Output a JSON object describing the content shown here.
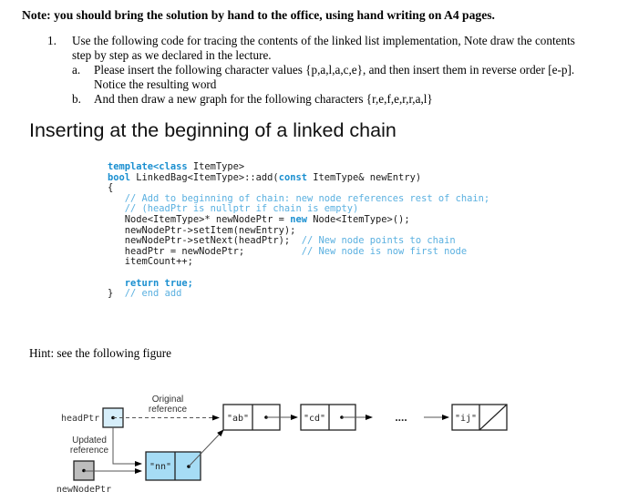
{
  "note": "Note: you should bring the solution by hand to the office, using hand writing on A4 pages.",
  "question": {
    "number": "1.",
    "text_line1": "Use the following code for tracing the contents of the linked list implementation, Note draw the contents",
    "text_line2": "step by step as we declared in the lecture.",
    "parts": [
      {
        "label": "a.",
        "line1": "Please insert the following character values {p,a,l,a,c,e}, and then insert them in reverse order [e-p].",
        "line2": "Notice the resulting word"
      },
      {
        "label": "b.",
        "line1": "And then draw a new graph for the following characters  {r,e,f,e,r,r,a,l}"
      }
    ]
  },
  "heading": "Inserting at the beginning of a linked chain",
  "code": {
    "line1_kw": "template<class",
    "line1_rest": " ItemType>",
    "line2_kw": "bool",
    "line2_a": " LinkedBag<ItemType>::add(",
    "line2_kw2": "const",
    "line2_b": " ItemType& newEntry)",
    "line3": "{",
    "line4": "   // Add to beginning of chain: new node references rest of chain;",
    "line5": "   // (headPtr is nullptr if chain is empty)",
    "line6_a": "   Node<ItemType>* newNodePtr = ",
    "line6_kw": "new",
    "line6_b": " Node<ItemType>();",
    "line7": "   newNodePtr->setItem(newEntry);",
    "line8_a": "   newNodePtr->setNext(headPtr);  ",
    "line8_c": "// New node points to chain",
    "line9_a": "   headPtr = newNodePtr;          ",
    "line9_c": "// New node is now first node",
    "line10": "   itemCount++;",
    "line11": "",
    "line12_kw": "   return true;",
    "line13_a": "}  ",
    "line13_c": "// end add"
  },
  "hint": "Hint: see the following figure",
  "figure": {
    "head_label": "headPtr",
    "original_ref_line1": "Original",
    "original_ref_line2": "reference",
    "updated_ref_line1": "Updated",
    "updated_ref_line2": "reference",
    "new_node_label": "newNodePtr",
    "nodes": [
      "\"ab\"",
      "\"cd\"",
      "\"ij\""
    ],
    "new_node_value": "\"nn\"",
    "ellipsis": "....",
    "colors": {
      "head_fill": "#d6eefa",
      "new_node_fill": "#a6dcf5",
      "newptr_fill": "#bdbdbd"
    }
  }
}
